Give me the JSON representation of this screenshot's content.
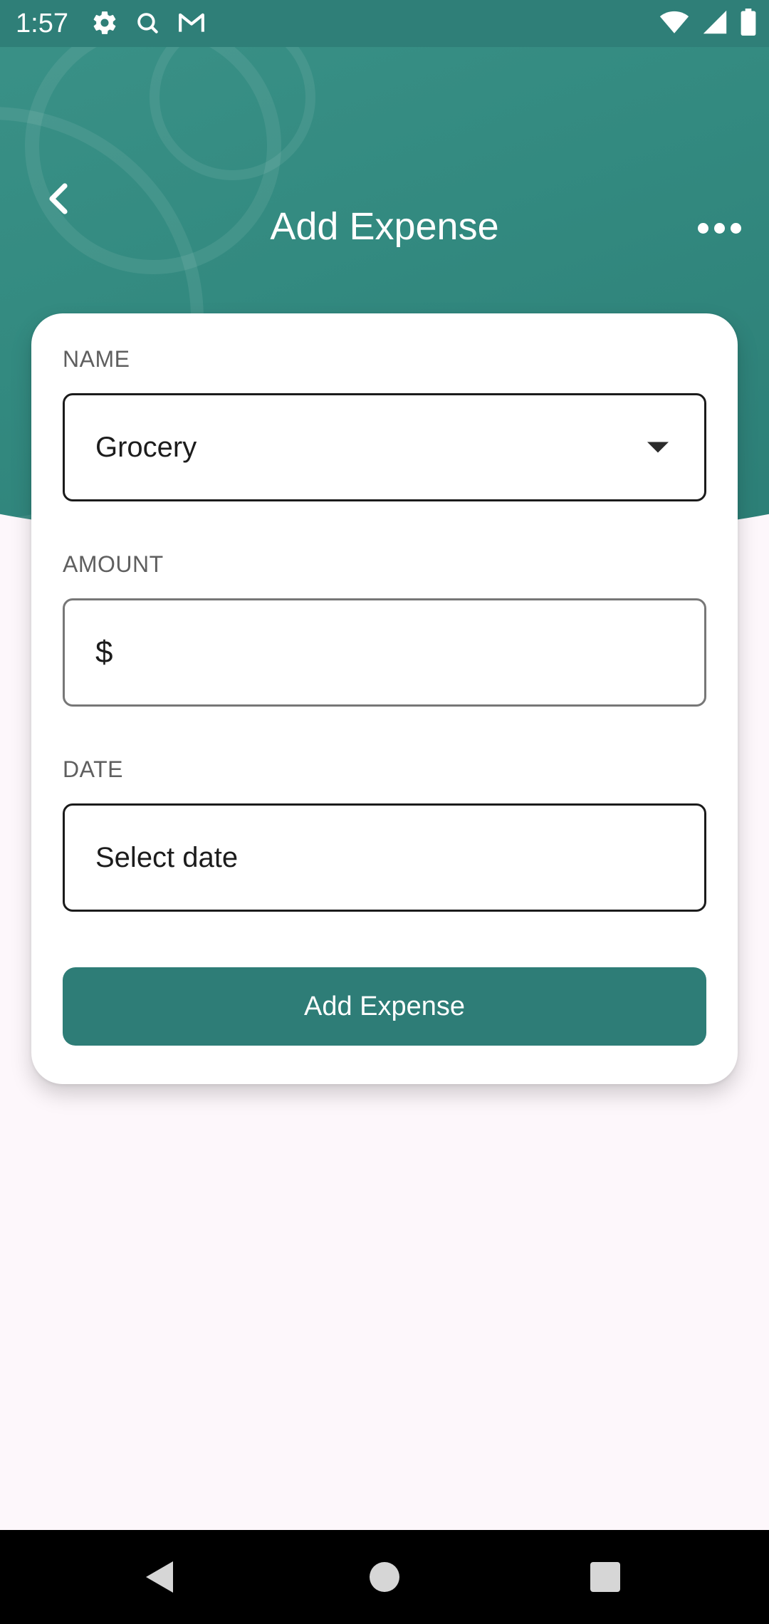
{
  "status_bar": {
    "time": "1:57",
    "left_icons": [
      "gear-icon",
      "search-icon",
      "gmail-icon"
    ],
    "right_icons": [
      "wifi-icon",
      "cell-signal-icon",
      "battery-icon"
    ]
  },
  "app_bar": {
    "title": "Add Expense",
    "back_icon": "chevron-left-icon",
    "more_icon": "more-horizontal-icon"
  },
  "form": {
    "name": {
      "label": "NAME",
      "selected_value": "Grocery"
    },
    "amount": {
      "label": "AMOUNT",
      "prefix": "$",
      "value": "",
      "placeholder": ""
    },
    "date": {
      "label": "DATE",
      "placeholder": "Select date"
    },
    "submit_label": "Add Expense"
  },
  "colors": {
    "primary": "#2e7d77",
    "header": "#338a80",
    "status_bar": "#2f7f78",
    "background": "#fdf7fb"
  },
  "nav_bar": {
    "buttons": [
      "back-icon",
      "home-icon",
      "recents-icon"
    ]
  }
}
